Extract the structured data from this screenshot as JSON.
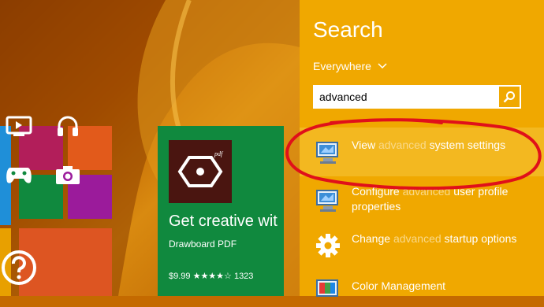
{
  "start_screen": {
    "tiles": {
      "video": {
        "icon": "video-icon"
      },
      "music": {
        "icon": "headphones-icon"
      },
      "games": {
        "icon": "xbox-controller-icon"
      },
      "camera": {
        "icon": "camera-icon"
      },
      "help": {
        "icon": "question-mark-icon"
      }
    },
    "store_tile": {
      "app_icon": "drawboard-pdf-logo",
      "title": "Get creative wit",
      "subtitle": "Drawboard PDF",
      "price": "$9.99 ★★★★☆ 1323"
    }
  },
  "search": {
    "title": "Search",
    "scope": "Everywhere",
    "query": "advanced",
    "button_icon": "magnifier-icon",
    "results": [
      {
        "icon": "system-settings-icon",
        "pre": "View ",
        "hl": "advanced",
        "post": " system settings"
      },
      {
        "icon": "system-settings-icon",
        "pre": "Configure ",
        "hl": "advanced",
        "post": " user profile properties"
      },
      {
        "icon": "gear-icon",
        "pre": "Change ",
        "hl": "advanced",
        "post": " startup options"
      },
      {
        "icon": "color-management-icon",
        "pre": "Color Management",
        "hl": "",
        "post": ""
      }
    ]
  },
  "colors": {
    "charm_background": "#f0a800",
    "highlight_row": "#f3b820",
    "match_text": "#f9d98a",
    "annotation": "#e0101a"
  }
}
